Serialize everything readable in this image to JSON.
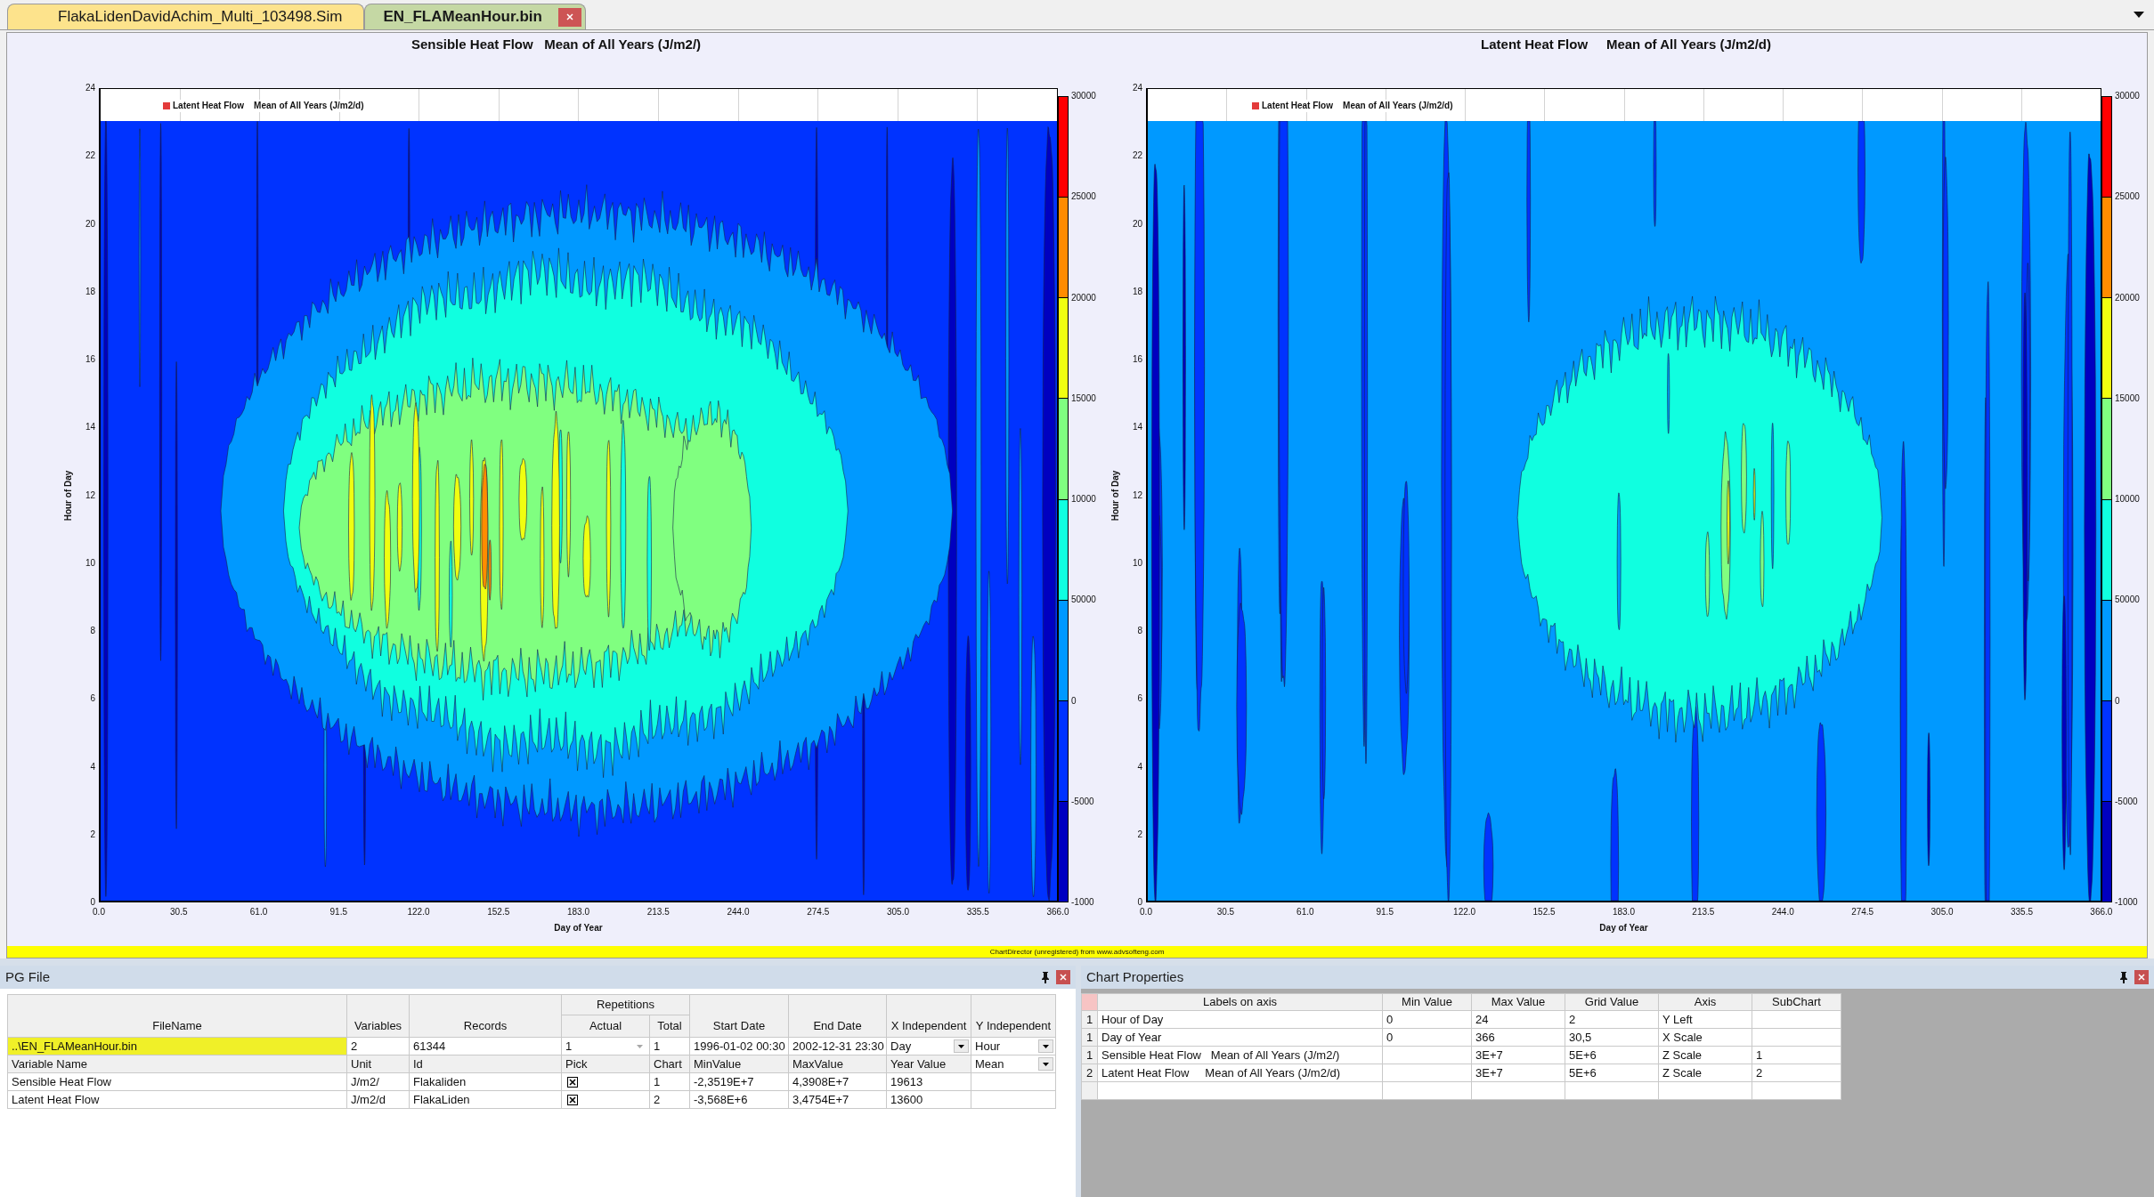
{
  "tabs": [
    {
      "label": "FlakaLidenDavidAchim_Multi_103498.Sim",
      "selected": false,
      "closable": false
    },
    {
      "label": "EN_FLAMeanHour.bin",
      "selected": true,
      "closable": true
    }
  ],
  "charts": [
    {
      "title": "Sensible Heat Flow   Mean of All Years (J/m2/)",
      "legend": {
        "label": "Latent Heat Flow    Mean of All Years (J/m2/d)",
        "color": "#e33b3b"
      },
      "y_label": "Hour of Day",
      "y_ticks": [
        "24",
        "22",
        "20",
        "18",
        "16",
        "14",
        "12",
        "10",
        "8",
        "6",
        "4",
        "2",
        "0"
      ],
      "x_label": "Day of Year",
      "x_ticks": [
        "0.0",
        "30.5",
        "61.0",
        "91.5",
        "122.0",
        "152.5",
        "183.0",
        "213.5",
        "244.0",
        "274.5",
        "305.0",
        "335.5",
        "366.0"
      ],
      "colorbar": {
        "labels": [
          "30000",
          "25000",
          "20000",
          "15000",
          "10000",
          "50000",
          "0",
          "-5000",
          "-1000"
        ],
        "bands": [
          {
            "color": "#ff0000"
          },
          {
            "color": "#ff8c00"
          },
          {
            "color": "#f0ff10"
          },
          {
            "color": "#80ff80"
          },
          {
            "color": "#10ffe0"
          },
          {
            "color": "#0099ff"
          },
          {
            "color": "#0033ff"
          },
          {
            "color": "#0000c0"
          }
        ]
      }
    },
    {
      "title": "Latent Heat Flow     Mean of All Years (J/m2/d)",
      "legend": {
        "label": "Latent Heat Flow    Mean of All Years (J/m2/d)",
        "color": "#e33b3b"
      },
      "y_label": "Hour of Day",
      "y_ticks": [
        "24",
        "22",
        "20",
        "18",
        "16",
        "14",
        "12",
        "10",
        "8",
        "6",
        "4",
        "2",
        "0"
      ],
      "x_label": "Day of Year",
      "x_ticks": [
        "0.0",
        "30.5",
        "61.0",
        "91.5",
        "122.0",
        "152.5",
        "183.0",
        "213.5",
        "244.0",
        "274.5",
        "305.0",
        "335.5",
        "366.0"
      ],
      "colorbar": {
        "labels": [
          "30000",
          "25000",
          "20000",
          "15000",
          "10000",
          "50000",
          "0",
          "-5000",
          "-1000"
        ],
        "bands": [
          {
            "color": "#ff0000"
          },
          {
            "color": "#ff8c00"
          },
          {
            "color": "#f0ff10"
          },
          {
            "color": "#80ff80"
          },
          {
            "color": "#10ffe0"
          },
          {
            "color": "#0099ff"
          },
          {
            "color": "#0033ff"
          },
          {
            "color": "#0000c0"
          }
        ]
      }
    }
  ],
  "notice": "ChartDirector (unregistered) from www.advsofteng.com",
  "pg_file": {
    "title": "PG File",
    "columns": [
      "FileName",
      "Variables",
      "Records",
      "Actual",
      "Total",
      "Start Date",
      "End Date",
      "X Independent",
      "Y Independent"
    ],
    "group_header": "Repetitions",
    "file": {
      "filename": "..\\EN_FLAMeanHour.bin",
      "selected": true,
      "variables": "2",
      "records": "61344",
      "actual": {
        "value": "1",
        "disabled": true
      },
      "total": "1",
      "start_date": "1996-01-02 00:30",
      "end_date": "2002-12-31 23:30",
      "x_independent": {
        "value": "Day",
        "disabled": false
      },
      "y_independent": {
        "value": "Hour",
        "disabled": false
      }
    },
    "variable_columns": [
      "Variable Name",
      "Unit",
      "Id",
      "Pick",
      "Chart",
      "MinValue",
      "MaxValue",
      "Year Value"
    ],
    "variable_mean": {
      "value": "Mean",
      "disabled": false
    },
    "variables": [
      {
        "name": "Sensible Heat Flow",
        "unit": "J/m2/",
        "id": "Flakaliden",
        "pick": true,
        "chart": "1",
        "min_value": "-2,3519E+7",
        "max_value": "4,3908E+7",
        "year_value": "19613"
      },
      {
        "name": "Latent Heat Flow",
        "unit": "J/m2/d",
        "id": "FlakaLiden",
        "pick": true,
        "chart": "2",
        "min_value": "-3,568E+6",
        "max_value": "3,4754E+7",
        "year_value": "13600"
      }
    ]
  },
  "chart_properties": {
    "title": "Chart Properties",
    "columns": [
      "Labels on axis",
      "Min Value",
      "Max Value",
      "Grid Value",
      "Axis",
      "SubChart"
    ],
    "rows": [
      {
        "index": "1",
        "label": "Hour of Day",
        "min": "0",
        "max": "24",
        "grid": "2",
        "axis": "Y Left"
      },
      {
        "index": "1",
        "label": "Day of Year",
        "min": "0",
        "max": "366",
        "grid": "30,5",
        "axis": "X Scale"
      },
      {
        "index": "1",
        "label": "Sensible Heat Flow   Mean of All Years (J/m2/)",
        "max": "3E+7",
        "grid": "5E+6",
        "axis": "Z Scale",
        "subchart": "1"
      },
      {
        "index": "2",
        "label": "Latent Heat Flow     Mean of All Years (J/m2/d)",
        "max": "3E+7",
        "grid": "5E+6",
        "axis": "Z Scale",
        "subchart": "2"
      }
    ]
  }
}
